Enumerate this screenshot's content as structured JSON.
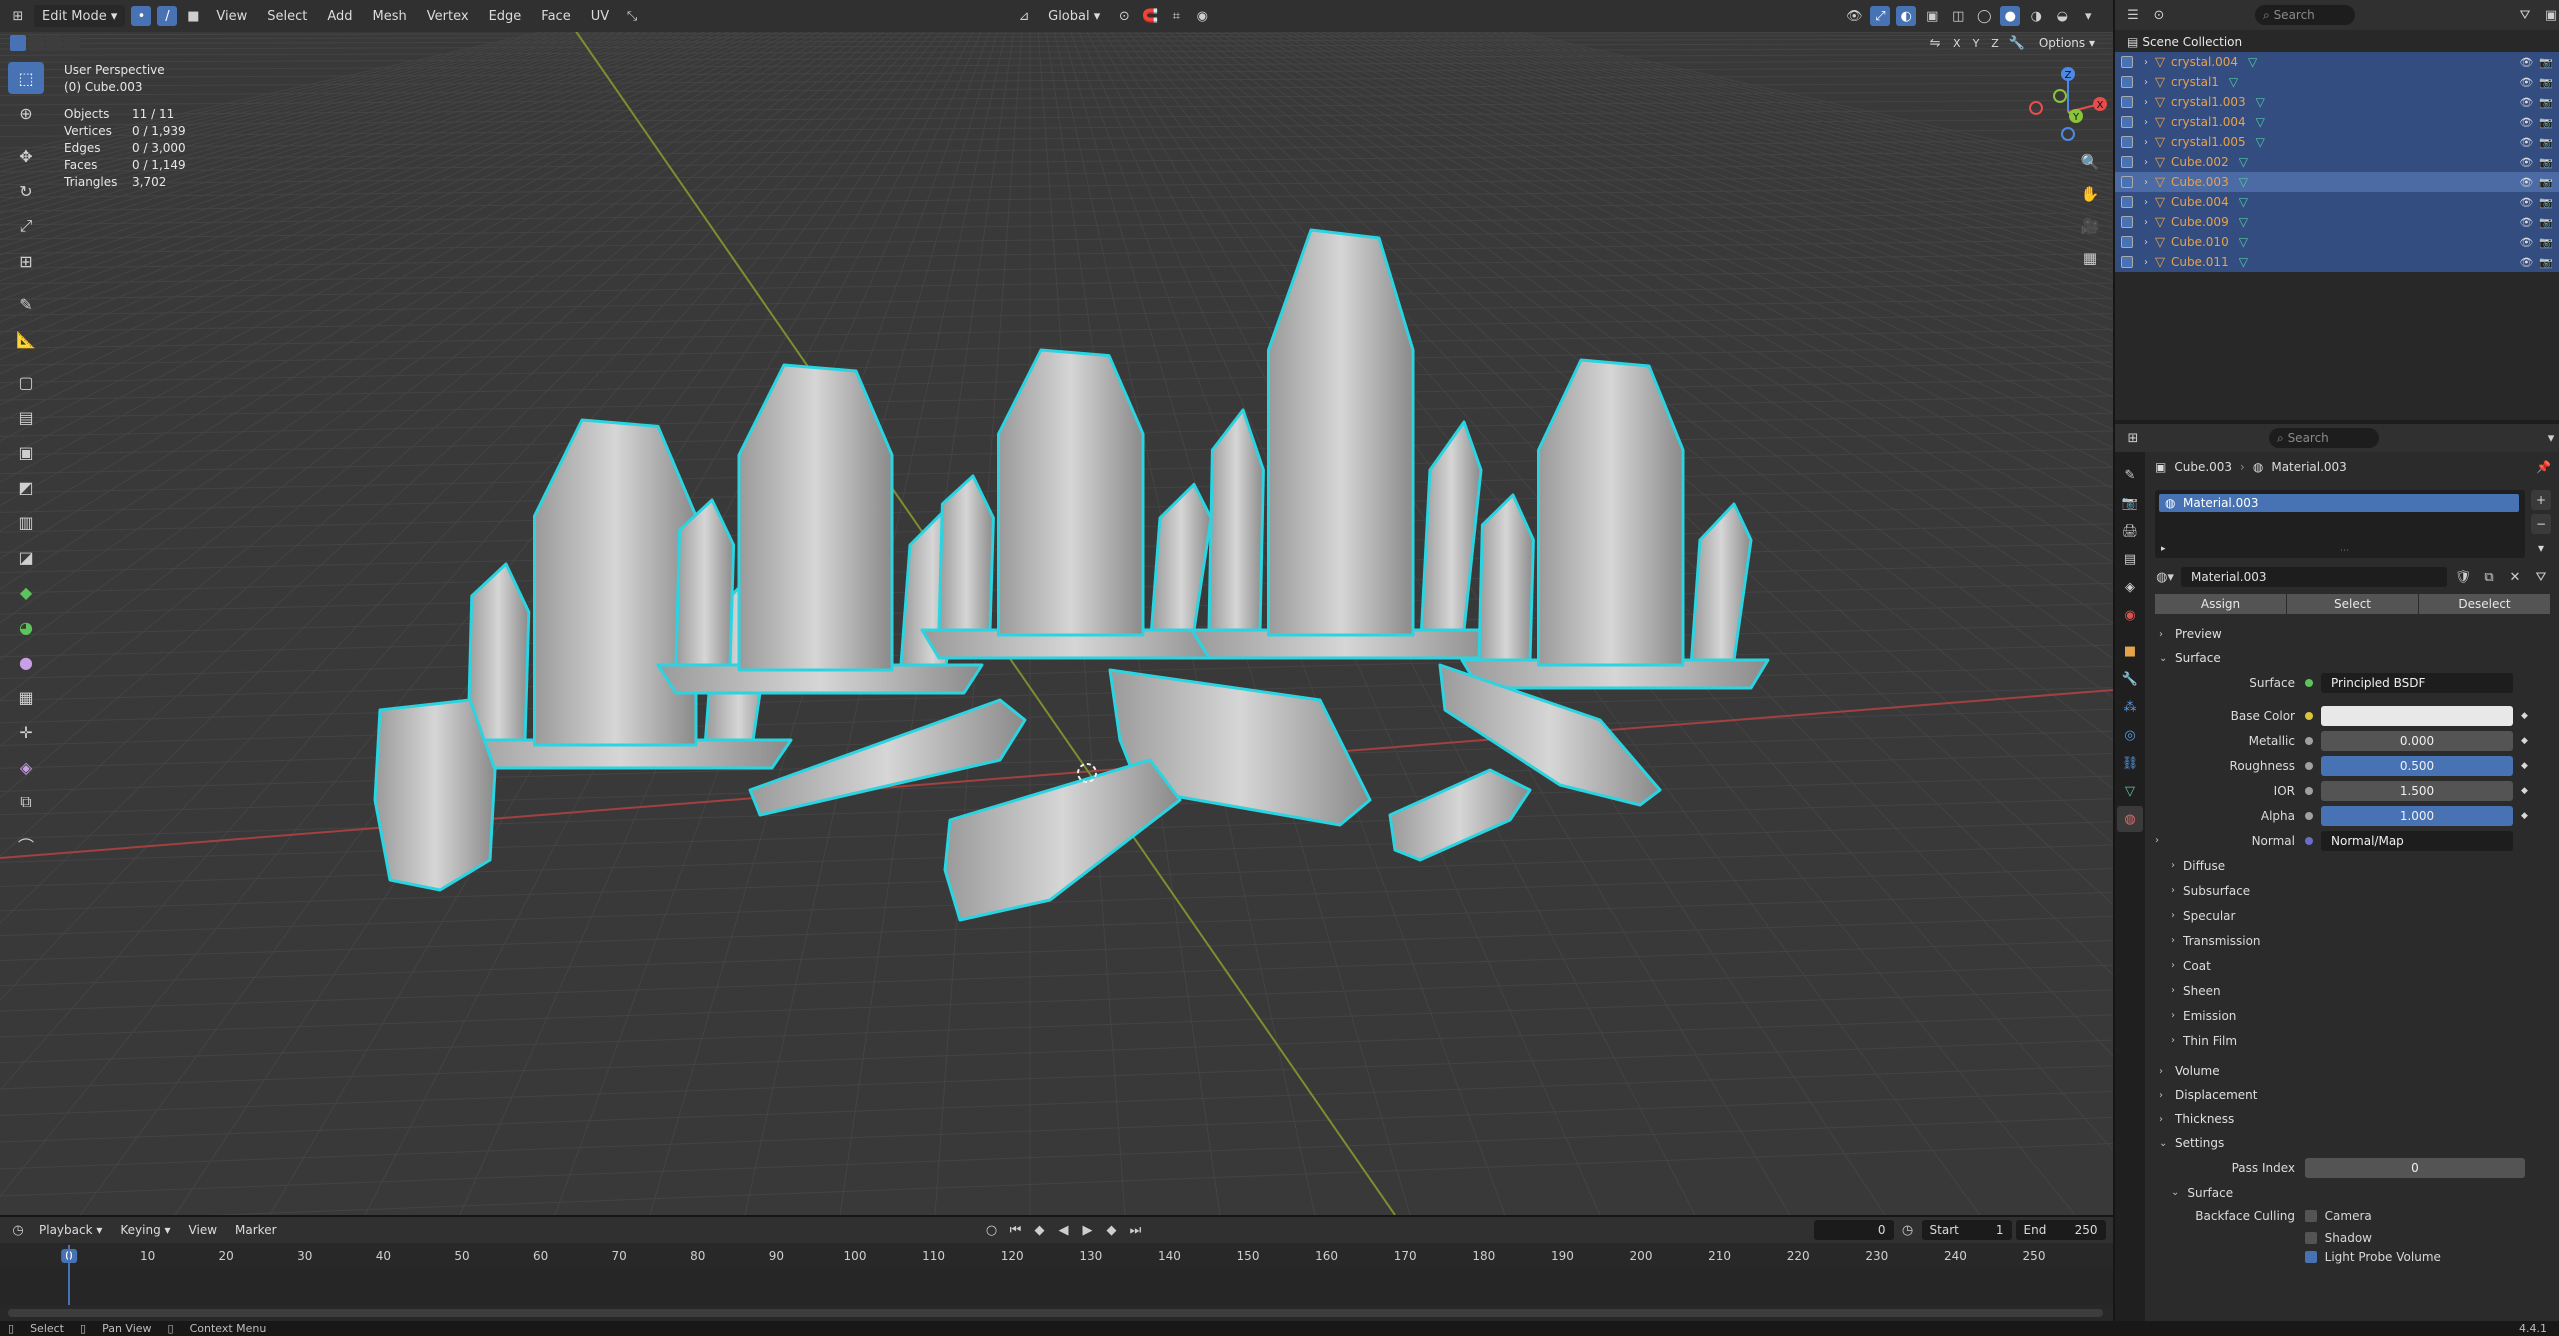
{
  "viewport": {
    "mode_label": "Edit Mode",
    "menus": [
      "View",
      "Select",
      "Add",
      "Mesh",
      "Vertex",
      "Edge",
      "Face",
      "UV"
    ],
    "orientation": "Global",
    "options_label": "Options",
    "info": {
      "perspective": "User Perspective",
      "object": "(0) Cube.003",
      "rows": [
        {
          "k": "Objects",
          "v": "11 / 11"
        },
        {
          "k": "Vertices",
          "v": "0 / 1,939"
        },
        {
          "k": "Edges",
          "v": "0 / 3,000"
        },
        {
          "k": "Faces",
          "v": "0 / 1,149"
        },
        {
          "k": "Triangles",
          "v": "3,702"
        }
      ]
    },
    "gizmo_axes": [
      "X",
      "Y",
      "Z"
    ]
  },
  "timeline": {
    "menus": [
      "Playback",
      "Keying",
      "View",
      "Marker"
    ],
    "current_frame": "0",
    "start_label": "Start",
    "start": "1",
    "end_label": "End",
    "end": "250",
    "ticks": [
      "0",
      "10",
      "20",
      "30",
      "40",
      "50",
      "60",
      "70",
      "80",
      "90",
      "100",
      "110",
      "120",
      "130",
      "140",
      "150",
      "160",
      "170",
      "180",
      "190",
      "200",
      "210",
      "220",
      "230",
      "240",
      "250"
    ]
  },
  "statusbar": {
    "items": [
      "Select",
      "Pan View",
      "Context Menu"
    ],
    "version": "4.4.1"
  },
  "outliner": {
    "search_placeholder": "Search",
    "root": "Scene Collection",
    "items": [
      {
        "name": "crystal.004",
        "active": false
      },
      {
        "name": "crystal1",
        "active": false
      },
      {
        "name": "crystal1.003",
        "active": false
      },
      {
        "name": "crystal1.004",
        "active": false
      },
      {
        "name": "crystal1.005",
        "active": false
      },
      {
        "name": "Cube.002",
        "active": false
      },
      {
        "name": "Cube.003",
        "active": true
      },
      {
        "name": "Cube.004",
        "active": false
      },
      {
        "name": "Cube.009",
        "active": false
      },
      {
        "name": "Cube.010",
        "active": false
      },
      {
        "name": "Cube.011",
        "active": false
      }
    ]
  },
  "properties": {
    "search_placeholder": "Search",
    "breadcrumb_object": "Cube.003",
    "breadcrumb_material": "Material.003",
    "slot": "Material.003",
    "material_name": "Material.003",
    "assign": "Assign",
    "select": "Select",
    "deselect": "Deselect",
    "preview": "Preview",
    "surface_panel": "Surface",
    "surface_label": "Surface",
    "surface_value": "Principled BSDF",
    "fields": [
      {
        "label": "Base Color",
        "value": "",
        "color": "#e8e8e8",
        "dot": "#d8c53a"
      },
      {
        "label": "Metallic",
        "value": "0.000",
        "color": "#545454",
        "dot": "#a0a0a0"
      },
      {
        "label": "Roughness",
        "value": "0.500",
        "color": "#4772b3",
        "dot": "#a0a0a0"
      },
      {
        "label": "IOR",
        "value": "1.500",
        "color": "#545454",
        "dot": "#a0a0a0"
      },
      {
        "label": "Alpha",
        "value": "1.000",
        "color": "#4772b3",
        "dot": "#a0a0a0"
      }
    ],
    "normal_label": "Normal",
    "normal_value": "Normal/Map",
    "subpanels": [
      "Diffuse",
      "Subsurface",
      "Specular",
      "Transmission",
      "Coat",
      "Sheen",
      "Emission",
      "Thin Film"
    ],
    "volume": "Volume",
    "displacement": "Displacement",
    "thickness": "Thickness",
    "settings": "Settings",
    "pass_index_label": "Pass Index",
    "pass_index": "0",
    "surface_sub": "Surface",
    "backface_label": "Backface Culling",
    "camera": "Camera",
    "shadow": "Shadow",
    "light_probe": "Light Probe Volume"
  },
  "colors": {
    "accent": "#4772b3",
    "selection_outline": "#2ad4e0",
    "object_orange": "#e8a24a",
    "mesh_green": "#55c9a5"
  }
}
